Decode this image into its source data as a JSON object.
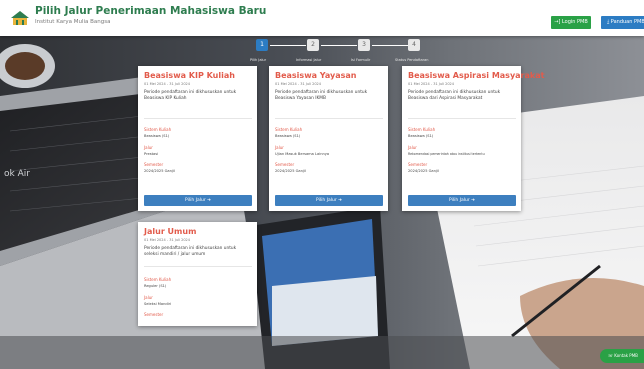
{
  "header": {
    "title": "Pilih Jalur Penerimaan Mahasiswa Baru",
    "subtitle": "Institut Karya Mulia Bangsa",
    "login_label": "→] Login PMB",
    "panduan_label": "⤓ Panduan PMB"
  },
  "stepper": {
    "steps": [
      {
        "number": "1",
        "label": "Pilih Jalur"
      },
      {
        "number": "2",
        "label": "Informasi Jalur"
      },
      {
        "number": "3",
        "label": "Isi Formulir"
      },
      {
        "number": "4",
        "label": "Status Pendaftaran"
      }
    ]
  },
  "cards": [
    {
      "title": "Beasiswa KIP Kuliah",
      "dates": "01 Mei 2024 - 31 Juli 2024",
      "description": "Periode pendaftaran ini dikhususkan untuk Beasiswa KIP Kuliah",
      "program_label": "Sistem Kuliah",
      "program_value": "Beasiswa (S1)",
      "jalur_label": "Jalur",
      "jalur_value": "Prestasi",
      "semester_label": "Semester",
      "semester_value": "2024/2025 Ganjil",
      "button_label": "Pilih Jalur ➔"
    },
    {
      "title": "Beasiswa Yayasan",
      "dates": "01 Mei 2024 - 31 Juli 2024",
      "description": "Periode pendaftaran ini dikhususkan untuk Beasiswa Yayasan IKMB",
      "program_label": "Sistem Kuliah",
      "program_value": "Beasiswa (S1)",
      "jalur_label": "Jalur",
      "jalur_value": "Ujian Masuk Bersama Lainnya",
      "semester_label": "Semester",
      "semester_value": "2024/2025 Ganjil",
      "button_label": "Pilih Jalur ➔"
    },
    {
      "title": "Beasiswa Aspirasi Masyarakat",
      "dates": "01 Mei 2024 - 31 Juli 2024",
      "description": "Periode pendaftaran ini dikhususkan untuk Beasiswa dari Aspirasi Masyarakat",
      "program_label": "Sistem Kuliah",
      "program_value": "Beasiswa (S1)",
      "jalur_label": "Jalur",
      "jalur_value": "Rekomendasi pemerintah atau institusi tertentu",
      "semester_label": "Semester",
      "semester_value": "2024/2025 Ganjil",
      "button_label": "Pilih Jalur ➔"
    },
    {
      "title": "Jalur Umum",
      "dates": "01 Mei 2024 - 31 Juli 2024",
      "description": "Periode pendaftaran ini dikhususkan untuk seleksi mandiri / jalur umum",
      "program_label": "Sistem Kuliah",
      "program_value": "Reguler (S1)",
      "jalur_label": "Jalur",
      "jalur_value": "Seleksi Mandiri",
      "semester_label": "Semester",
      "semester_value": ""
    }
  ],
  "whatsapp": {
    "label": "Kontak PMB"
  },
  "colors": {
    "brand_green": "#2e7d4f",
    "card_title_red": "#e25b4b",
    "button_blue": "#3d7fbf",
    "login_green": "#2aa146"
  }
}
